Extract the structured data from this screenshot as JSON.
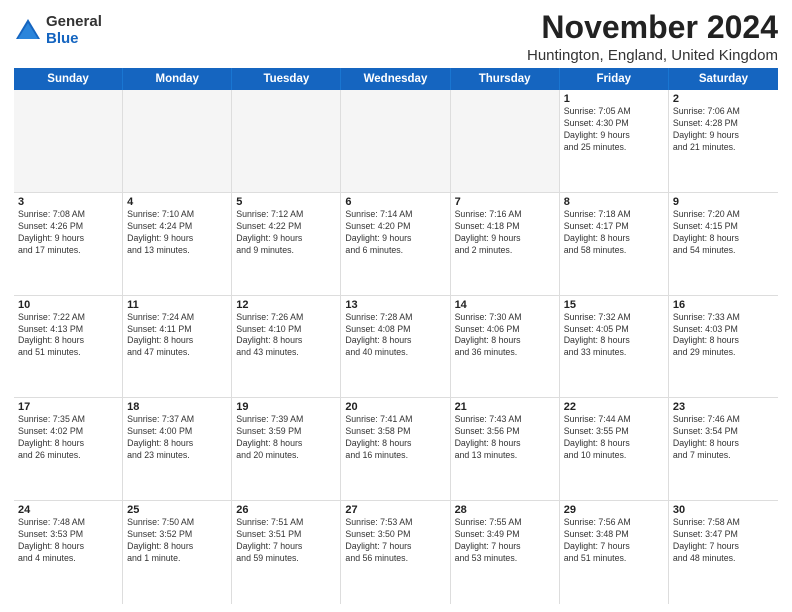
{
  "logo": {
    "general": "General",
    "blue": "Blue"
  },
  "title": "November 2024",
  "location": "Huntington, England, United Kingdom",
  "header_days": [
    "Sunday",
    "Monday",
    "Tuesday",
    "Wednesday",
    "Thursday",
    "Friday",
    "Saturday"
  ],
  "rows": [
    [
      {
        "day": "",
        "info": "",
        "empty": true
      },
      {
        "day": "",
        "info": "",
        "empty": true
      },
      {
        "day": "",
        "info": "",
        "empty": true
      },
      {
        "day": "",
        "info": "",
        "empty": true
      },
      {
        "day": "",
        "info": "",
        "empty": true
      },
      {
        "day": "1",
        "info": "Sunrise: 7:05 AM\nSunset: 4:30 PM\nDaylight: 9 hours\nand 25 minutes."
      },
      {
        "day": "2",
        "info": "Sunrise: 7:06 AM\nSunset: 4:28 PM\nDaylight: 9 hours\nand 21 minutes."
      }
    ],
    [
      {
        "day": "3",
        "info": "Sunrise: 7:08 AM\nSunset: 4:26 PM\nDaylight: 9 hours\nand 17 minutes."
      },
      {
        "day": "4",
        "info": "Sunrise: 7:10 AM\nSunset: 4:24 PM\nDaylight: 9 hours\nand 13 minutes."
      },
      {
        "day": "5",
        "info": "Sunrise: 7:12 AM\nSunset: 4:22 PM\nDaylight: 9 hours\nand 9 minutes."
      },
      {
        "day": "6",
        "info": "Sunrise: 7:14 AM\nSunset: 4:20 PM\nDaylight: 9 hours\nand 6 minutes."
      },
      {
        "day": "7",
        "info": "Sunrise: 7:16 AM\nSunset: 4:18 PM\nDaylight: 9 hours\nand 2 minutes."
      },
      {
        "day": "8",
        "info": "Sunrise: 7:18 AM\nSunset: 4:17 PM\nDaylight: 8 hours\nand 58 minutes."
      },
      {
        "day": "9",
        "info": "Sunrise: 7:20 AM\nSunset: 4:15 PM\nDaylight: 8 hours\nand 54 minutes."
      }
    ],
    [
      {
        "day": "10",
        "info": "Sunrise: 7:22 AM\nSunset: 4:13 PM\nDaylight: 8 hours\nand 51 minutes."
      },
      {
        "day": "11",
        "info": "Sunrise: 7:24 AM\nSunset: 4:11 PM\nDaylight: 8 hours\nand 47 minutes."
      },
      {
        "day": "12",
        "info": "Sunrise: 7:26 AM\nSunset: 4:10 PM\nDaylight: 8 hours\nand 43 minutes."
      },
      {
        "day": "13",
        "info": "Sunrise: 7:28 AM\nSunset: 4:08 PM\nDaylight: 8 hours\nand 40 minutes."
      },
      {
        "day": "14",
        "info": "Sunrise: 7:30 AM\nSunset: 4:06 PM\nDaylight: 8 hours\nand 36 minutes."
      },
      {
        "day": "15",
        "info": "Sunrise: 7:32 AM\nSunset: 4:05 PM\nDaylight: 8 hours\nand 33 minutes."
      },
      {
        "day": "16",
        "info": "Sunrise: 7:33 AM\nSunset: 4:03 PM\nDaylight: 8 hours\nand 29 minutes."
      }
    ],
    [
      {
        "day": "17",
        "info": "Sunrise: 7:35 AM\nSunset: 4:02 PM\nDaylight: 8 hours\nand 26 minutes."
      },
      {
        "day": "18",
        "info": "Sunrise: 7:37 AM\nSunset: 4:00 PM\nDaylight: 8 hours\nand 23 minutes."
      },
      {
        "day": "19",
        "info": "Sunrise: 7:39 AM\nSunset: 3:59 PM\nDaylight: 8 hours\nand 20 minutes."
      },
      {
        "day": "20",
        "info": "Sunrise: 7:41 AM\nSunset: 3:58 PM\nDaylight: 8 hours\nand 16 minutes."
      },
      {
        "day": "21",
        "info": "Sunrise: 7:43 AM\nSunset: 3:56 PM\nDaylight: 8 hours\nand 13 minutes."
      },
      {
        "day": "22",
        "info": "Sunrise: 7:44 AM\nSunset: 3:55 PM\nDaylight: 8 hours\nand 10 minutes."
      },
      {
        "day": "23",
        "info": "Sunrise: 7:46 AM\nSunset: 3:54 PM\nDaylight: 8 hours\nand 7 minutes."
      }
    ],
    [
      {
        "day": "24",
        "info": "Sunrise: 7:48 AM\nSunset: 3:53 PM\nDaylight: 8 hours\nand 4 minutes."
      },
      {
        "day": "25",
        "info": "Sunrise: 7:50 AM\nSunset: 3:52 PM\nDaylight: 8 hours\nand 1 minute."
      },
      {
        "day": "26",
        "info": "Sunrise: 7:51 AM\nSunset: 3:51 PM\nDaylight: 7 hours\nand 59 minutes."
      },
      {
        "day": "27",
        "info": "Sunrise: 7:53 AM\nSunset: 3:50 PM\nDaylight: 7 hours\nand 56 minutes."
      },
      {
        "day": "28",
        "info": "Sunrise: 7:55 AM\nSunset: 3:49 PM\nDaylight: 7 hours\nand 53 minutes."
      },
      {
        "day": "29",
        "info": "Sunrise: 7:56 AM\nSunset: 3:48 PM\nDaylight: 7 hours\nand 51 minutes."
      },
      {
        "day": "30",
        "info": "Sunrise: 7:58 AM\nSunset: 3:47 PM\nDaylight: 7 hours\nand 48 minutes."
      }
    ]
  ]
}
